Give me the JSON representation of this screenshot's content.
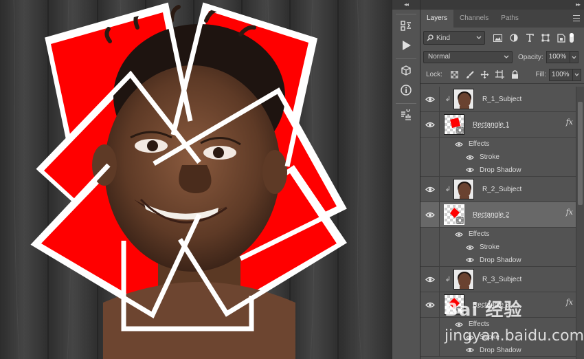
{
  "panel": {
    "tabs": [
      {
        "label": "Layers",
        "active": true
      },
      {
        "label": "Channels",
        "active": false
      },
      {
        "label": "Paths",
        "active": false
      }
    ],
    "filter": {
      "kind_label": "Kind"
    },
    "blend_mode": "Normal",
    "opacity_label": "Opacity:",
    "opacity_value": "100%",
    "lock_label": "Lock:",
    "fill_label": "Fill:",
    "fill_value": "100%"
  },
  "layers": [
    {
      "name": "R_1_Subject",
      "type": "subject",
      "clipped": true,
      "visible": true
    },
    {
      "name": "Rectangle 1",
      "type": "shape",
      "fx": "fx",
      "visible": true,
      "selected": false,
      "effects_label": "Effects",
      "effects": [
        "Stroke",
        "Drop Shadow"
      ]
    },
    {
      "name": "R_2_Subject",
      "type": "subject",
      "clipped": true,
      "visible": true
    },
    {
      "name": "Rectangle 2",
      "type": "shape",
      "fx": "fx",
      "visible": true,
      "selected": true,
      "effects_label": "Effects",
      "effects": [
        "Stroke",
        "Drop Shadow"
      ]
    },
    {
      "name": "R_3_Subject",
      "type": "subject",
      "clipped": true,
      "visible": true
    },
    {
      "name": "Rectangle 3",
      "type": "shape",
      "fx": "fx",
      "visible": true,
      "selected": false,
      "effects_label": "Effects",
      "effects": [
        "Stroke",
        "Drop Shadow"
      ]
    }
  ],
  "watermark": {
    "line1": "Bai 经验",
    "line2": "jingyan.baidu.com"
  },
  "colors": {
    "accent_red": "#ff0000",
    "panel_bg": "#535353",
    "wood": "#3d3d3d"
  }
}
